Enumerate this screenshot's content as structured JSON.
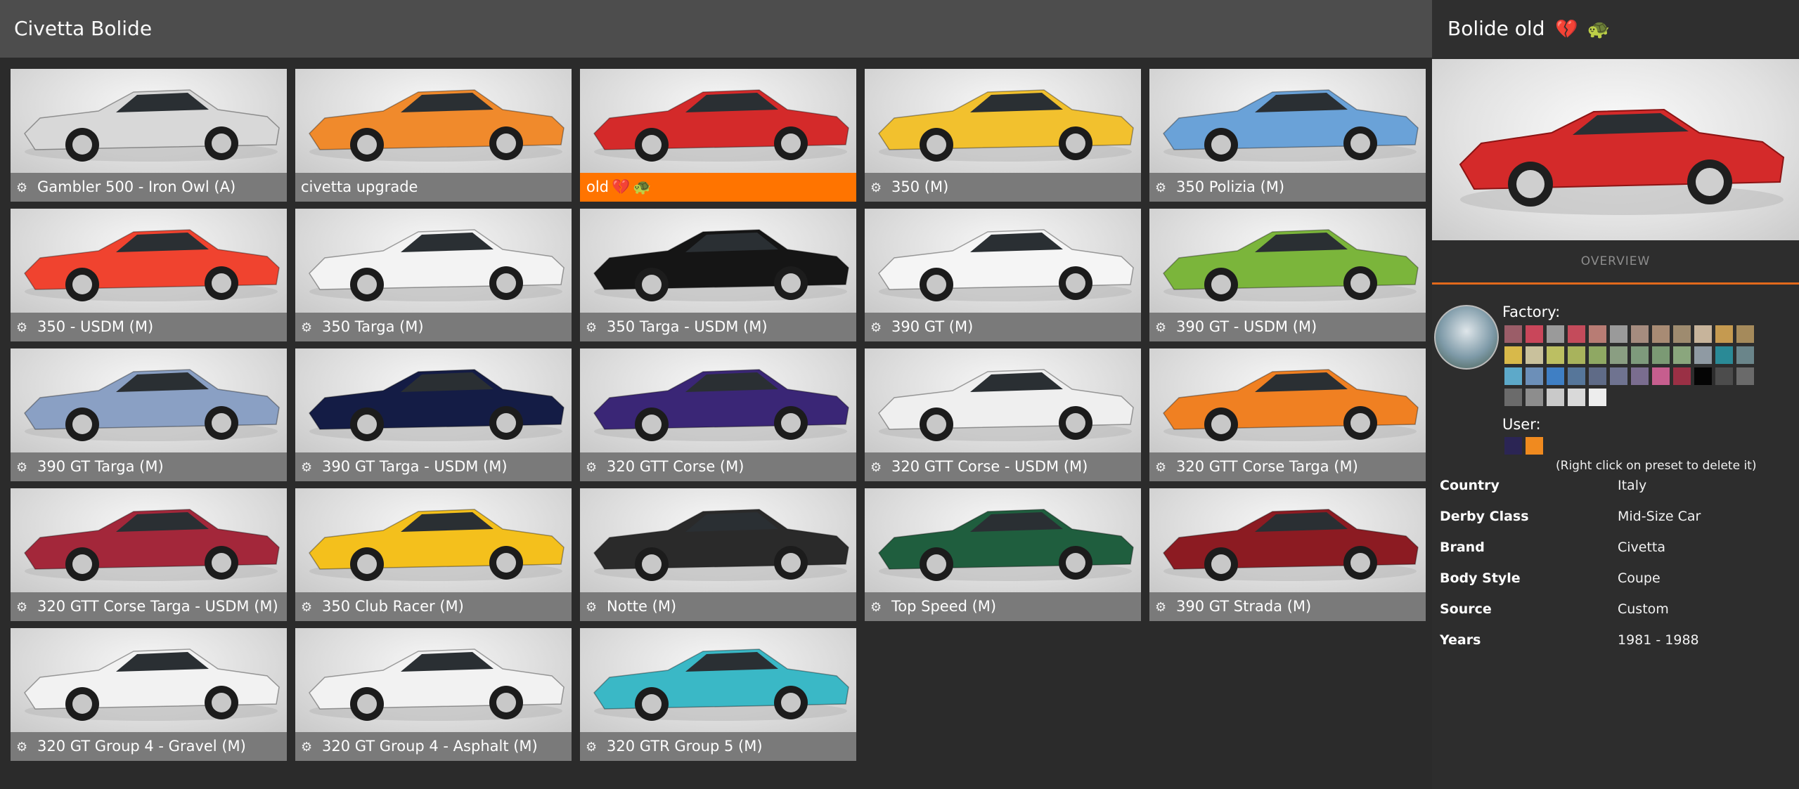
{
  "header": {
    "title": "Civetta Bolide"
  },
  "grid": {
    "items": [
      {
        "label": "Gambler 500 - Iron Owl (A)",
        "icon": "config-icon",
        "color": "#d8d8d8",
        "selected": false
      },
      {
        "label": "civetta upgrade",
        "icon": "",
        "color": "#f08a2c",
        "selected": false
      },
      {
        "label": "old",
        "icon": "",
        "color": "#d42a2a",
        "selected": true,
        "badges": [
          "💔",
          "🐢"
        ]
      },
      {
        "label": "350 (M)",
        "icon": "config-icon",
        "color": "#f2c12e",
        "selected": false
      },
      {
        "label": "350 Polizia (M)",
        "icon": "config-icon",
        "color": "#6aa2d8",
        "selected": false
      },
      {
        "label": "350 - USDM (M)",
        "icon": "config-icon",
        "color": "#f0432f",
        "selected": false
      },
      {
        "label": "350 Targa (M)",
        "icon": "config-icon",
        "color": "#f3f3f3",
        "selected": false
      },
      {
        "label": "350 Targa - USDM (M)",
        "icon": "config-icon",
        "color": "#151515",
        "selected": false
      },
      {
        "label": "390 GT (M)",
        "icon": "config-icon",
        "color": "#f5f5f5",
        "selected": false
      },
      {
        "label": "390 GT - USDM (M)",
        "icon": "config-icon",
        "color": "#7bb53b",
        "selected": false
      },
      {
        "label": "390 GT Targa (M)",
        "icon": "config-icon",
        "color": "#8aa0c4",
        "selected": false
      },
      {
        "label": "390 GT Targa - USDM (M)",
        "icon": "config-icon",
        "color": "#141c45",
        "selected": false
      },
      {
        "label": "320 GTT Corse (M)",
        "icon": "config-icon",
        "color": "#3a2676",
        "selected": false
      },
      {
        "label": "320 GTT Corse - USDM (M)",
        "icon": "config-icon",
        "color": "#efefef",
        "selected": false
      },
      {
        "label": "320 GTT Corse Targa (M)",
        "icon": "config-icon",
        "color": "#f08022",
        "selected": false
      },
      {
        "label": "320 GTT Corse Targa - USDM (M)",
        "icon": "config-icon",
        "color": "#a3273a",
        "selected": false
      },
      {
        "label": "350 Club Racer (M)",
        "icon": "config-icon",
        "color": "#f4c01c",
        "selected": false
      },
      {
        "label": "Notte (M)",
        "icon": "config-icon",
        "color": "#2a2a2a",
        "selected": false
      },
      {
        "label": "Top Speed (M)",
        "icon": "config-icon",
        "color": "#1f5e3e",
        "selected": false
      },
      {
        "label": "390 GT Strada (M)",
        "icon": "config-icon",
        "color": "#8c1b22",
        "selected": false
      },
      {
        "label": "320 GT Group 4 - Gravel (M)",
        "icon": "config-icon",
        "color": "#f2f2f2",
        "selected": false
      },
      {
        "label": "320 GT Group 4 - Asphalt (M)",
        "icon": "config-icon",
        "color": "#f2f2f2",
        "selected": false
      },
      {
        "label": "320 GTR Group 5 (M)",
        "icon": "config-icon",
        "color": "#3ab8c6",
        "selected": false
      }
    ]
  },
  "panel": {
    "title": "Bolide old",
    "title_badges": [
      "💔",
      "🐢"
    ],
    "car_color": "#d42a2a",
    "tab_overview": "OVERVIEW",
    "factory_label": "Factory:",
    "user_label": "User:",
    "hint": "(Right click on preset to delete it)",
    "factory_colors": [
      "#9b5d68",
      "#c9465a",
      "#9a9a9a",
      "#c44b5b",
      "#b87c74",
      "#9a9a9a",
      "#a58c7f",
      "#a88b74",
      "#9e8b6f",
      "#c7b49b",
      "#c59a50",
      "#a58a5b",
      "#d8b94a",
      "#c9c19c",
      "#bcbf62",
      "#a8b35c",
      "#8fa863",
      "#8a9e82",
      "#7e9a7c",
      "#7b9a74",
      "#8aa67d",
      "#8f9aa3",
      "#2a8a96",
      "#6a858a",
      "#5da9c9",
      "#6c8fb8",
      "#3f7fc4",
      "#56769a",
      "#5f6b87",
      "#6f7390",
      "#7a6d8f",
      "#c65e8e",
      "#9a3045",
      "#050505",
      "#4c4c4c",
      "#6a6a6a",
      "#6b6b6b",
      "#8d8d8d",
      "#c9c9c9",
      "#d9d9d9",
      "#ededed"
    ],
    "user_colors": [
      "#2b2554",
      "#f08a1f"
    ],
    "properties": [
      {
        "key": "Country",
        "value": "Italy"
      },
      {
        "key": "Derby Class",
        "value": "Mid-Size Car"
      },
      {
        "key": "Brand",
        "value": "Civetta"
      },
      {
        "key": "Body Style",
        "value": "Coupe"
      },
      {
        "key": "Source",
        "value": "Custom"
      },
      {
        "key": "Years",
        "value": "1981 - 1988"
      }
    ]
  }
}
